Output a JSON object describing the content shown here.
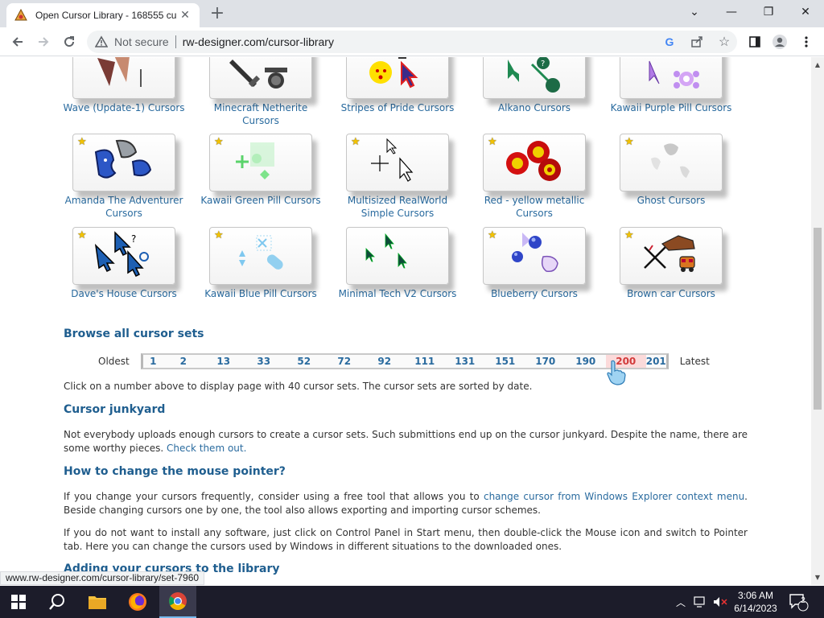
{
  "browser": {
    "tab_title": "Open Cursor Library - 168555 cu",
    "omnibox_status": "Not secure",
    "url": "rw-designer.com/cursor-library",
    "status_url": "www.rw-designer.com/cursor-library/set-7960"
  },
  "cards": [
    {
      "label": "Wave (Update-1) Cursors",
      "starred": false
    },
    {
      "label": "Minecraft Netherite Cursors",
      "starred": false
    },
    {
      "label": "Stripes of Pride Cursors",
      "starred": false
    },
    {
      "label": "Alkano Cursors",
      "starred": false
    },
    {
      "label": "Kawaii Purple Pill Cursors",
      "starred": false
    },
    {
      "label": "Amanda The Adventurer Cursors",
      "starred": true
    },
    {
      "label": "Kawaii Green Pill Cursors",
      "starred": true
    },
    {
      "label": "Multisized RealWorld Simple Cursors",
      "starred": true
    },
    {
      "label": "Red - yellow metallic Cursors",
      "starred": true
    },
    {
      "label": "Ghost Cursors",
      "starred": true
    },
    {
      "label": "Dave's House Cursors",
      "starred": true
    },
    {
      "label": "Kawaii Blue Pill Cursors",
      "starred": true
    },
    {
      "label": "Minimal Tech V2 Cursors",
      "starred": false
    },
    {
      "label": "Blueberry Cursors",
      "starred": true
    },
    {
      "label": "Brown car Cursors",
      "starred": true
    }
  ],
  "browse": {
    "heading": "Browse all cursor sets",
    "oldest": "Oldest",
    "latest": "Latest",
    "pages": [
      "1",
      "2",
      "13",
      "33",
      "52",
      "72",
      "92",
      "111",
      "131",
      "151",
      "170",
      "190",
      "200",
      "201"
    ],
    "active_page": "200",
    "hint": "Click on a number above to display page with 40 cursor sets. The cursor sets are sorted by date."
  },
  "junkyard": {
    "heading": "Cursor junkyard",
    "text": "Not everybody uploads enough cursors to create a cursor sets. Such submittions end up on the cursor junkyard. Despite the name, there are some worthy pieces.",
    "link": "Check them out."
  },
  "howto": {
    "heading": "How to change the mouse pointer?",
    "p1_a": "If you change your cursors frequently, consider using a free tool that allows you to",
    "p1_link": "change cursor from Windows Explorer context menu",
    "p1_b": ". Beside changing cursors one by one, the tool also allows exporting and importing cursor schemes.",
    "p2": "If you do not want to install any software, just click on Control Panel in Start menu, then double-click the Mouse icon and switch to Pointer tab. Here you can change the cursors used by Windows in different situations to the downloaded ones."
  },
  "adding": {
    "heading": "Adding your cursors to the library"
  },
  "taskbar": {
    "time": "3:06 AM",
    "date": "6/14/2023",
    "notifications": "2"
  },
  "colors": {
    "link": "#2a6b9f",
    "heading": "#1f5e8f",
    "active_page": "#d23b3b",
    "star": "#f2c200"
  }
}
